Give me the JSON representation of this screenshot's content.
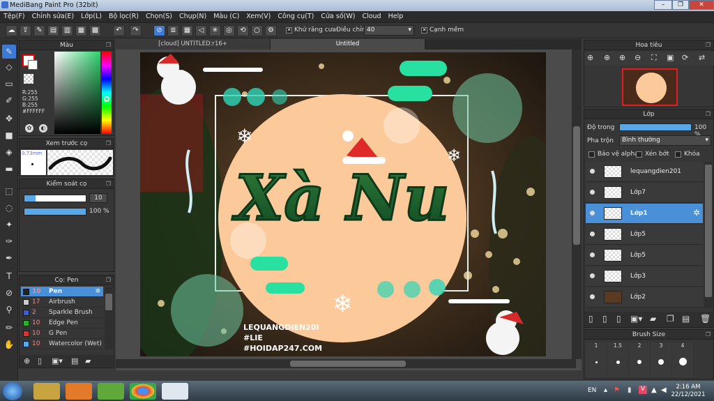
{
  "window": {
    "title": "MediBang Paint Pro (32bit)",
    "min": "–",
    "restore": "❐",
    "close": "✕"
  },
  "menu": [
    "Tệp(F)",
    "Chỉnh sửa(E)",
    "Lớp(L)",
    "Bộ lọc(R)",
    "Chọn(S)",
    "Chụp(N)",
    "Màu (C)",
    "Xem(V)",
    "Công cụ(T)",
    "Cửa số(W)",
    "Cloud",
    "Help"
  ],
  "toolbar": {
    "antialias_label": "Khử răng cưa",
    "adjust_label": "Điều chỉnh",
    "adjust_value": "40",
    "sharp_label": "Cạnh mềm"
  },
  "color_panel": {
    "title": "Màu",
    "r": "R:255",
    "g": "G:255",
    "b": "B:255",
    "hex": "#FFFFFF"
  },
  "preview_panel": {
    "title": "Xem trước cọ",
    "size": "0.73mm"
  },
  "brush_control": {
    "title": "Kiểm soát cọ",
    "size": "10",
    "opacity": "100 %"
  },
  "brush_panel": {
    "title": "Cọ: Pen",
    "items": [
      {
        "size": "10",
        "name": "Pen",
        "color": "#222222"
      },
      {
        "size": "17",
        "name": "Airbrush",
        "color": "#cccccc"
      },
      {
        "size": "2",
        "name": "Sparkle Brush",
        "color": "#3a5fd0"
      },
      {
        "size": "10",
        "name": "Edge Pen",
        "color": "#2ab02a"
      },
      {
        "size": "10",
        "name": "G Pen",
        "color": "#e03030"
      },
      {
        "size": "10",
        "name": "Watercolor (Wet)",
        "color": "#55aaee"
      }
    ]
  },
  "tabs": [
    "[cloud] UNTITLED:r16+",
    "Untitled"
  ],
  "artwork": {
    "title": "Xà Nu",
    "sign1": "LEQUANGDIEN20I",
    "sign2": "#LIE",
    "sign3": "#HOIDAP247.COM"
  },
  "navigator": {
    "title": "Hoa tiêu"
  },
  "layer_panel": {
    "title": "Lớp",
    "opacity_label": "Độ trong",
    "opacity_value": "100 %",
    "blend_label": "Pha trộn",
    "blend_value": "Bình thường",
    "protect_label": "Bảo vệ alpha",
    "clip_label": "Xén bớt",
    "lock_label": "Khóa",
    "layers": [
      "lequangdien201",
      "Lớp7",
      "Lớp1",
      "Lớp5",
      "Lớp5",
      "Lớp3",
      "Lớp2"
    ]
  },
  "brush_size": {
    "title": "Brush Size",
    "sizes": [
      "1",
      "1.5",
      "2",
      "3",
      "4"
    ]
  },
  "taskbar": {
    "lang": "EN",
    "time": "2:16 AM",
    "date": "22/12/2021"
  }
}
